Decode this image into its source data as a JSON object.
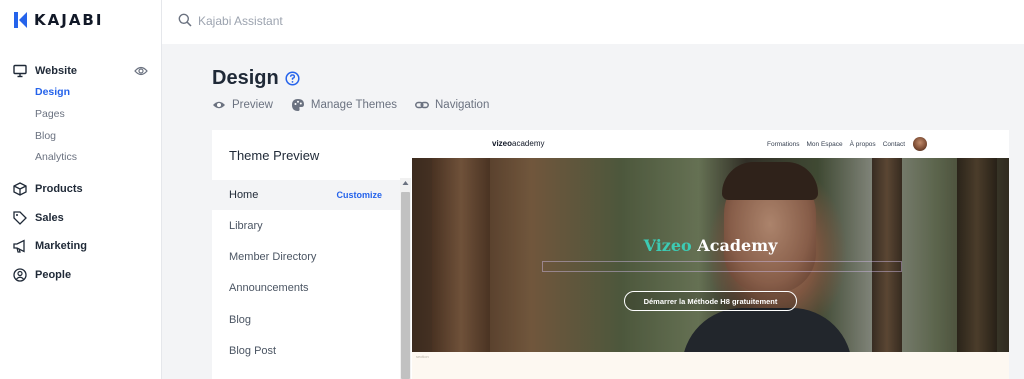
{
  "brand": {
    "name": "KAJABI",
    "accent": "#2563eb"
  },
  "search": {
    "placeholder": "Kajabi Assistant",
    "icon": "search-icon"
  },
  "sidebar": {
    "website": {
      "label": "Website",
      "icon": "monitor-icon",
      "toggle_icon": "eye-icon",
      "items": [
        {
          "label": "Design",
          "active": true
        },
        {
          "label": "Pages"
        },
        {
          "label": "Blog"
        },
        {
          "label": "Analytics"
        }
      ]
    },
    "sections": [
      {
        "label": "Products",
        "icon": "cube-icon"
      },
      {
        "label": "Sales",
        "icon": "tag-icon"
      },
      {
        "label": "Marketing",
        "icon": "megaphone-icon"
      },
      {
        "label": "People",
        "icon": "user-circle-icon"
      }
    ]
  },
  "main": {
    "title": "Design",
    "help_icon": "question-circle-icon",
    "subnav": [
      {
        "label": "Preview",
        "icon": "eye-icon"
      },
      {
        "label": "Manage Themes",
        "icon": "palette-icon"
      },
      {
        "label": "Navigation",
        "icon": "link-icon"
      }
    ]
  },
  "theme_preview": {
    "title": "Theme Preview",
    "customize_label": "Customize",
    "pages": [
      {
        "label": "Home",
        "active": true
      },
      {
        "label": "Library"
      },
      {
        "label": "Member Directory"
      },
      {
        "label": "Announcements"
      },
      {
        "label": "Blog"
      },
      {
        "label": "Blog Post"
      }
    ]
  },
  "site_preview": {
    "logo_bold": "vizeo",
    "logo_rest": "academy",
    "nav": [
      "Formations",
      "Mon Espace",
      "À propos",
      "Contact"
    ],
    "hero_title_accent": "Vizeo",
    "hero_title_rest": " Academy",
    "cta_label": "Démarrer la Méthode H8 gratuitement",
    "section_label": "section",
    "hero_accent_color": "#3ccbb4"
  }
}
